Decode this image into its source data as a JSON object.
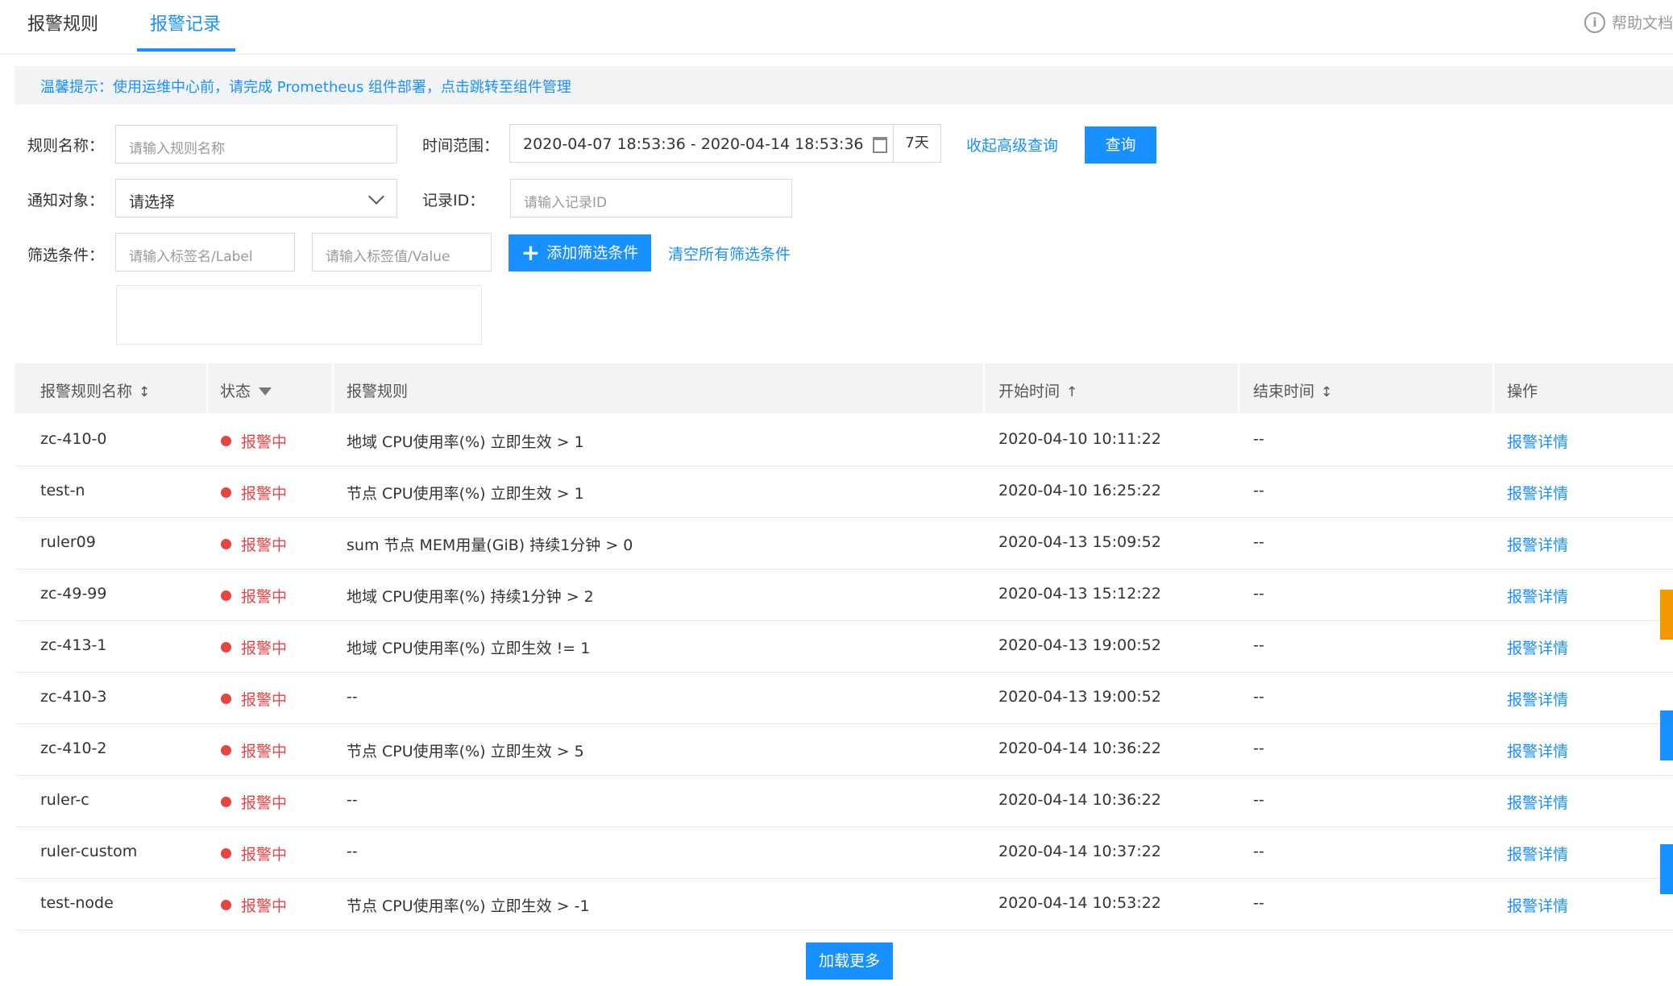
{
  "tabs": [
    {
      "label": "报警规则"
    },
    {
      "label": "报警记录"
    }
  ],
  "help": {
    "label": "帮助文档",
    "icon": "info-icon"
  },
  "notice": {
    "text": "温馨提示：使用运维中心前，请完成 Prometheus 组件部署，点击跳转至组件管理"
  },
  "form": {
    "rule_name": {
      "label": "规则名称：",
      "placeholder": "请输入规则名称"
    },
    "time_range": {
      "label": "时间范围：",
      "value": "2020-04-07 18:53:36 - 2020-04-14 18:53:36",
      "preset": "7天"
    },
    "collapse_link": "收起高级查询",
    "query_button": "查询",
    "notify_target": {
      "label": "通知对象：",
      "value": "请选择"
    },
    "record_id": {
      "label": "记录ID：",
      "placeholder": "请输入记录ID"
    },
    "filter": {
      "label": "筛选条件：",
      "label_placeholder": "请输入标签名/Label",
      "value_placeholder": "请输入标签值/Value",
      "add_button": "添加筛选条件",
      "clear_link": "清空所有筛选条件"
    }
  },
  "table": {
    "columns": [
      "报警规则名称",
      "状态",
      "报警规则",
      "开始时间",
      "结束时间",
      "操作"
    ],
    "rows": [
      {
        "name": "zc-410-0",
        "status": "报警中",
        "rule": "地域 CPU使用率(%) 立即生效 > 1",
        "start": "2020-04-10 10:11:22",
        "end": "--",
        "action": "报警详情"
      },
      {
        "name": "test-n",
        "status": "报警中",
        "rule": "节点 CPU使用率(%) 立即生效 > 1",
        "start": "2020-04-10 16:25:22",
        "end": "--",
        "action": "报警详情"
      },
      {
        "name": "ruler09",
        "status": "报警中",
        "rule": "sum 节点 MEM用量(GiB) 持续1分钟 > 0",
        "start": "2020-04-13 15:09:52",
        "end": "--",
        "action": "报警详情"
      },
      {
        "name": "zc-49-99",
        "status": "报警中",
        "rule": "地域 CPU使用率(%) 持续1分钟 > 2",
        "start": "2020-04-13 15:12:22",
        "end": "--",
        "action": "报警详情"
      },
      {
        "name": "zc-413-1",
        "status": "报警中",
        "rule": "地域 CPU使用率(%) 立即生效 != 1",
        "start": "2020-04-13 19:00:52",
        "end": "--",
        "action": "报警详情"
      },
      {
        "name": "zc-410-3",
        "status": "报警中",
        "rule": "--",
        "start": "2020-04-13 19:00:52",
        "end": "--",
        "action": "报警详情"
      },
      {
        "name": "zc-410-2",
        "status": "报警中",
        "rule": "节点 CPU使用率(%) 立即生效 > 5",
        "start": "2020-04-14 10:36:22",
        "end": "--",
        "action": "报警详情"
      },
      {
        "name": "ruler-c",
        "status": "报警中",
        "rule": "--",
        "start": "2020-04-14 10:36:22",
        "end": "--",
        "action": "报警详情"
      },
      {
        "name": "ruler-custom",
        "status": "报警中",
        "rule": "--",
        "start": "2020-04-14 10:37:22",
        "end": "--",
        "action": "报警详情"
      },
      {
        "name": "test-node",
        "status": "报警中",
        "rule": "节点 CPU使用率(%) 立即生效 > -1",
        "start": "2020-04-14 10:53:22",
        "end": "--",
        "action": "报警详情"
      }
    ]
  },
  "load_more": "加载更多",
  "colors": {
    "accent": "#1890ff",
    "alert": "#e54545",
    "side_orange": "#f39800"
  }
}
